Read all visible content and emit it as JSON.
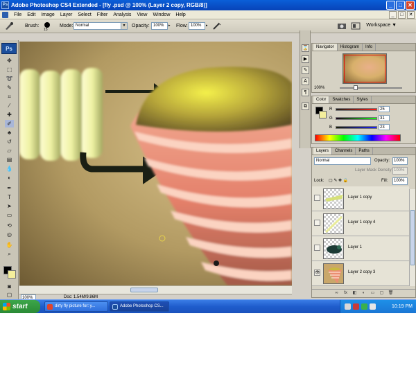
{
  "window": {
    "title": "Adobe Photoshop CS4 Extended - [fly .psd @ 100% (Layer 2 copy, RGB/8)]",
    "minimize": "_",
    "maximize": "□",
    "close": "✕"
  },
  "menubar": {
    "items": [
      "File",
      "Edit",
      "Image",
      "Layer",
      "Select",
      "Filter",
      "Analysis",
      "View",
      "Window",
      "Help"
    ],
    "doc_min": "_",
    "doc_restore": "□",
    "doc_close": "✕"
  },
  "options": {
    "brush_label": "Brush:",
    "brush_size": "15",
    "mode_label": "Mode:",
    "mode_value": "Normal",
    "opacity_label": "Opacity:",
    "opacity_value": "100%",
    "flow_label": "Flow:",
    "flow_value": "100%",
    "workspace_label": "Workspace ▼"
  },
  "tools": {
    "logo": "Ps",
    "icons": [
      "move-tool",
      "marquee-tool",
      "lasso-tool",
      "quick-select-tool",
      "crop-tool",
      "eyedropper-tool",
      "healing-tool",
      "brush-tool",
      "clone-stamp-tool",
      "history-brush-tool",
      "eraser-tool",
      "gradient-tool",
      "blur-tool",
      "dodge-tool",
      "pen-tool",
      "type-tool",
      "path-select-tool",
      "shape-tool",
      "3d-rotate-tool",
      "3d-orbit-tool",
      "hand-tool",
      "zoom-tool"
    ],
    "foreground_color": "#000000",
    "background_color": "#f4ee9c"
  },
  "status": {
    "zoom": "100%",
    "doc": "Doc: 1.54M/9.86M"
  },
  "navigator": {
    "tabs": [
      "Navigator",
      "Histogram",
      "Info"
    ],
    "zoom": "100%"
  },
  "color_panel": {
    "tabs": [
      "Color",
      "Swatches",
      "Styles"
    ],
    "r_label": "R",
    "g_label": "G",
    "b_label": "B",
    "r_value": "25",
    "g_value": "31",
    "b_value": "23"
  },
  "layers": {
    "tabs": [
      "Layers",
      "Channels",
      "Paths"
    ],
    "blend_mode": "Normal",
    "opacity_label": "Opacity:",
    "opacity_value": "100%",
    "mask_density_label": "Layer Mask Density:",
    "mask_density_value": "100%",
    "lock_label": "Lock:",
    "fill_label": "Fill:",
    "fill_value": "100%",
    "rows": [
      {
        "name": "Layer 1 copy",
        "visible": false,
        "selected": false
      },
      {
        "name": "Layer 1 copy 4",
        "visible": false,
        "selected": false
      },
      {
        "name": "Layer 1",
        "visible": false,
        "selected": false
      },
      {
        "name": "Layer 2 copy 3",
        "visible": true,
        "selected": false
      }
    ],
    "footer_icons": [
      "link-layers-icon",
      "fx-icon",
      "mask-icon",
      "adjustment-icon",
      "group-icon",
      "new-layer-icon",
      "delete-icon"
    ]
  },
  "taskbar": {
    "start_label": "start",
    "tasks": [
      {
        "label": "dirty fly picture for: y...",
        "active": false
      },
      {
        "label": "Adobe Photoshop CS...",
        "active": true
      }
    ],
    "clock": "10:19 PM"
  }
}
